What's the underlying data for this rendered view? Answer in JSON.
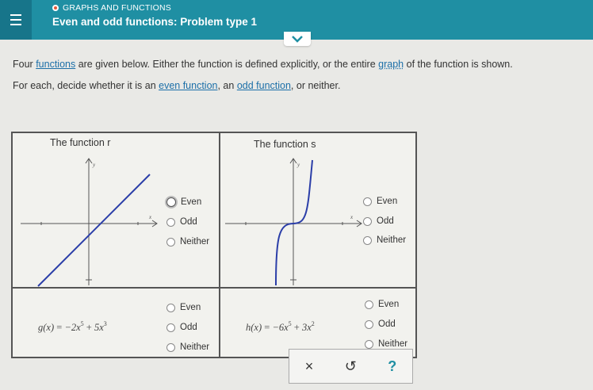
{
  "header": {
    "breadcrumb": "GRAPHS AND FUNCTIONS",
    "title": "Even and odd functions: Problem type 1"
  },
  "intro": {
    "line1_a": "Four ",
    "line1_link1": "functions",
    "line1_b": " are given below. Either the function is defined explicitly, or the entire ",
    "line1_link2": "graph",
    "line1_c": " of the function is shown.",
    "line2_a": "For each, decide whether it is an ",
    "line2_link1": "even function",
    "line2_b": ", an ",
    "line2_link2": "odd function",
    "line2_c": ", or neither."
  },
  "problems": {
    "r": {
      "label": "The function r"
    },
    "s": {
      "label": "The function s"
    },
    "g": {
      "lhs": "g(x)",
      "eq": "=",
      "t1": "−2x",
      "e1": "5",
      "op": "+",
      "t2": "5x",
      "e2": "3"
    },
    "h": {
      "lhs": "h(x)",
      "eq": "=",
      "t1": "−6x",
      "e1": "5",
      "op": "+",
      "t2": "3x",
      "e2": "2"
    }
  },
  "options": [
    "Even",
    "Odd",
    "Neither"
  ],
  "axis_labels": {
    "x": "x",
    "y": "y"
  },
  "footer": {
    "clear": "×",
    "undo": "↺",
    "help": "?"
  },
  "colors": {
    "header": "#1f8fa3",
    "curve": "#2b3ea8",
    "link": "#1c6fa8"
  }
}
